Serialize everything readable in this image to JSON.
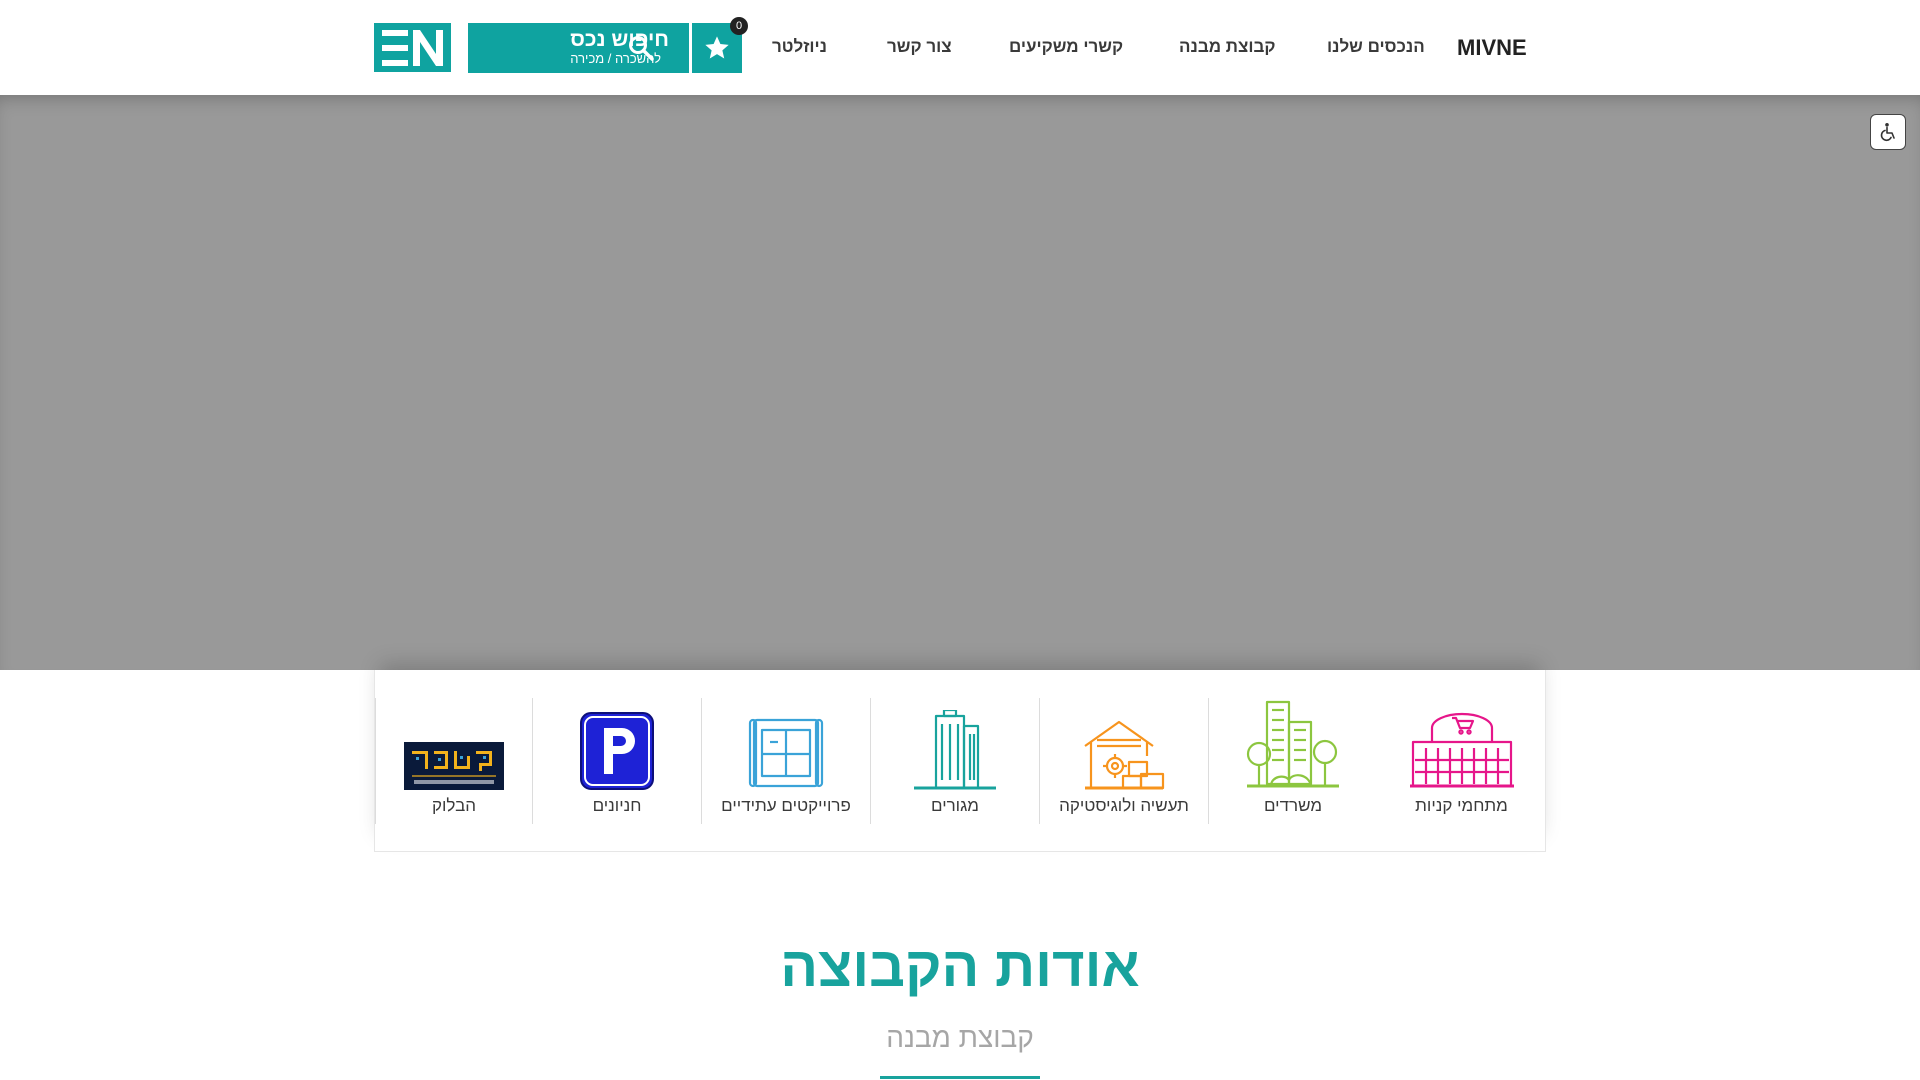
{
  "header": {
    "logo_en_text": "EN",
    "mivne_logo_text": "MIVNE",
    "search": {
      "title": "חיפוש נכס",
      "subtitle": "להשכרה / מכירה"
    },
    "favorites": {
      "count": "0"
    },
    "nav": [
      {
        "label": "ניוזלטר"
      },
      {
        "label": "צור קשר"
      },
      {
        "label": "קשרי משקיעים"
      },
      {
        "label": "קבוצת מבנה"
      },
      {
        "label": "הנכסים שלנו"
      }
    ]
  },
  "categories": [
    {
      "label": "מתחמי קניות",
      "icon": "shopping-mall-icon",
      "color": "#e6168a"
    },
    {
      "label": "משרדים",
      "icon": "office-buildings-icon",
      "color": "#8cc63f"
    },
    {
      "label": "תעשיה ולוגיסטיקה",
      "icon": "industry-logistics-icon",
      "color": "#f7941d"
    },
    {
      "label": "מגורים",
      "icon": "residential-tower-icon",
      "color": "#18a39d"
    },
    {
      "label": "פרוייקטים עתידיים",
      "icon": "blueprint-icon",
      "color": "#3aa3d8"
    },
    {
      "label": "חניונים",
      "icon": "parking-icon",
      "color": "#1e22d6"
    },
    {
      "label": "הבלוק",
      "icon": "the-block-logo",
      "color": "#0a1a3a"
    }
  ],
  "about": {
    "title": "אודות הקבוצה",
    "subtitle": "קבוצת מבנה"
  },
  "colors": {
    "brand": "#0fa3a0",
    "hero_bg": "#999999"
  }
}
